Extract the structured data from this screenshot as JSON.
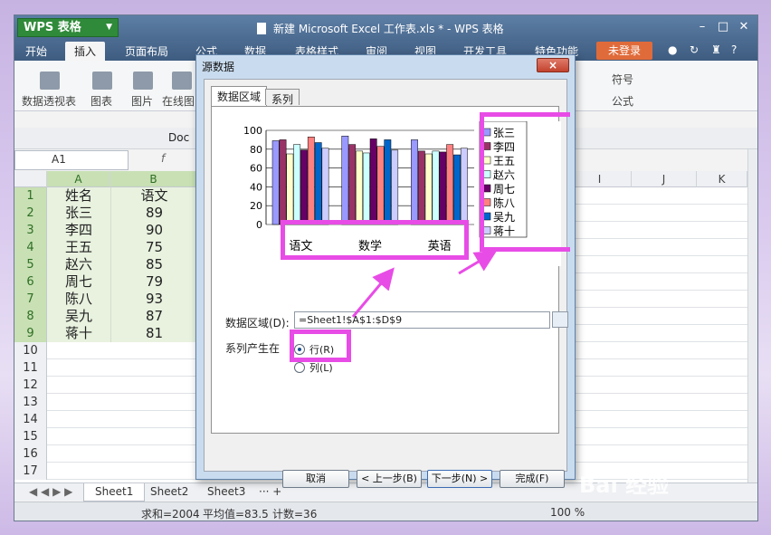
{
  "app": {
    "name": "WPS 表格",
    "window_title": "新建 Microsoft Excel 工作表.xls * - WPS 表格"
  },
  "menu": [
    "开始",
    "插入",
    "页面布局",
    "公式",
    "数据",
    "表格样式",
    "审阅",
    "视图",
    "开发工具",
    "特色功能"
  ],
  "login": "未登录",
  "ribbon": {
    "pivot": "数据透视表",
    "chart": "图表",
    "picture": "图片",
    "online": "在线图",
    "symbol": "符号",
    "formula": "公式"
  },
  "toolbar": {
    "doc_tab": "Doc"
  },
  "name_box": "A1",
  "fx": "f",
  "sheet": {
    "columns": [
      "A",
      "B"
    ],
    "right_columns": [
      "I",
      "J",
      "K"
    ],
    "rows": [
      {
        "n": "1",
        "a": "姓名",
        "b": "语文"
      },
      {
        "n": "2",
        "a": "张三",
        "b": "89"
      },
      {
        "n": "3",
        "a": "李四",
        "b": "90"
      },
      {
        "n": "4",
        "a": "王五",
        "b": "75"
      },
      {
        "n": "5",
        "a": "赵六",
        "b": "85"
      },
      {
        "n": "6",
        "a": "周七",
        "b": "79"
      },
      {
        "n": "7",
        "a": "陈八",
        "b": "93"
      },
      {
        "n": "8",
        "a": "吴九",
        "b": "87"
      },
      {
        "n": "9",
        "a": "蒋十",
        "b": "81"
      },
      {
        "n": "10",
        "a": "",
        "b": ""
      },
      {
        "n": "11",
        "a": "",
        "b": ""
      },
      {
        "n": "12",
        "a": "",
        "b": ""
      },
      {
        "n": "13",
        "a": "",
        "b": ""
      },
      {
        "n": "14",
        "a": "",
        "b": ""
      },
      {
        "n": "15",
        "a": "",
        "b": ""
      },
      {
        "n": "16",
        "a": "",
        "b": ""
      },
      {
        "n": "17",
        "a": "",
        "b": ""
      }
    ],
    "tabs": [
      "Sheet1",
      "Sheet2",
      "Sheet3"
    ]
  },
  "status": {
    "sum": "求和=2004",
    "avg": "平均值=83.5",
    "count": "计数=36",
    "zoom": "100 %"
  },
  "dialog": {
    "title": "源数据",
    "close": "×",
    "tabs": [
      "数据区域",
      "系列"
    ],
    "range_label": "数据区域(D):",
    "range_value": "=Sheet1!$A$1:$D$9",
    "series_label": "系列产生在",
    "opt_row": "行(R)",
    "opt_col": "列(L)",
    "buttons": {
      "cancel": "取消",
      "prev": "< 上一步(B)",
      "next": "下一步(N) >",
      "finish": "完成(F)"
    }
  },
  "chart_data": {
    "type": "bar",
    "categories": [
      "语文",
      "数学",
      "英语"
    ],
    "ylim": [
      0,
      100
    ],
    "yticks": [
      "0",
      "20",
      "40",
      "60",
      "80",
      "100"
    ],
    "series": [
      {
        "name": "张三",
        "values": [
          89,
          94,
          90
        ],
        "color": "#9999ff"
      },
      {
        "name": "李四",
        "values": [
          90,
          85,
          78
        ],
        "color": "#993366"
      },
      {
        "name": "王五",
        "values": [
          75,
          78,
          75
        ],
        "color": "#ffffcc"
      },
      {
        "name": "赵六",
        "values": [
          85,
          76,
          78
        ],
        "color": "#ccffff"
      },
      {
        "name": "周七",
        "values": [
          79,
          91,
          77
        ],
        "color": "#660066"
      },
      {
        "name": "陈八",
        "values": [
          93,
          83,
          85
        ],
        "color": "#ff8080"
      },
      {
        "name": "吴九",
        "values": [
          87,
          90,
          74
        ],
        "color": "#0066cc"
      },
      {
        "name": "蒋十",
        "values": [
          81,
          79,
          81
        ],
        "color": "#ccccff"
      }
    ],
    "legend_position": "right",
    "grid": true
  },
  "watermark": "Bai 经验"
}
